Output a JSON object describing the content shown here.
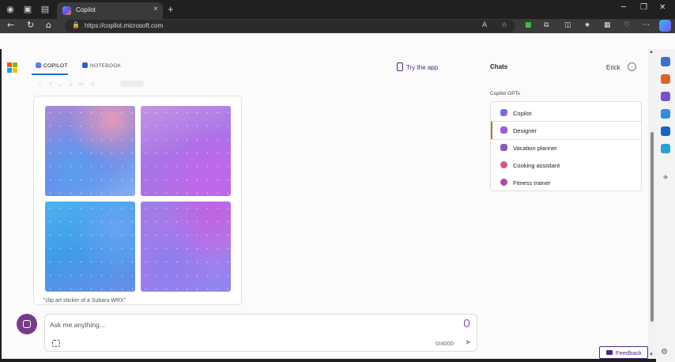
{
  "browser": {
    "tab_title": "Copilot",
    "url": "https://copilot.microsoft.com",
    "new_tab": "+",
    "tab_close": "×"
  },
  "page": {
    "top_tabs": [
      {
        "label": "COPILOT",
        "color": "#1f1f1f"
      },
      {
        "label": "NOTEBOOK",
        "color": "#555555"
      }
    ],
    "try_app": "Try the app",
    "image_caption": "\"clip art sticker of a Subaru WRX\"",
    "chat": {
      "placeholder": "Ask me anything...",
      "counter": "0/4000"
    },
    "right_panel": {
      "title": "Chats",
      "user_name": "Erick",
      "gpt_section_title": "Copilot GPTs",
      "gpts": [
        {
          "label": "Copilot",
          "icon": "copilot-icon",
          "color": "#4a9ee8",
          "selected": false
        },
        {
          "label": "Designer",
          "icon": "designer-icon",
          "color": "#a25ad6",
          "selected": true
        },
        {
          "label": "Vacation planner",
          "icon": "vacation-icon",
          "color": "#8a5ab8",
          "selected": false
        },
        {
          "label": "Cooking assistant",
          "icon": "cooking-icon",
          "color": "#d25a78",
          "selected": false
        },
        {
          "label": "Fitness trainer",
          "icon": "fitness-icon",
          "color": "#b04aa8",
          "selected": false
        }
      ]
    },
    "feedback": "Feedback"
  },
  "colors": {
    "accent": "#4c2a85",
    "tab_underline": "#1f6fd1"
  }
}
